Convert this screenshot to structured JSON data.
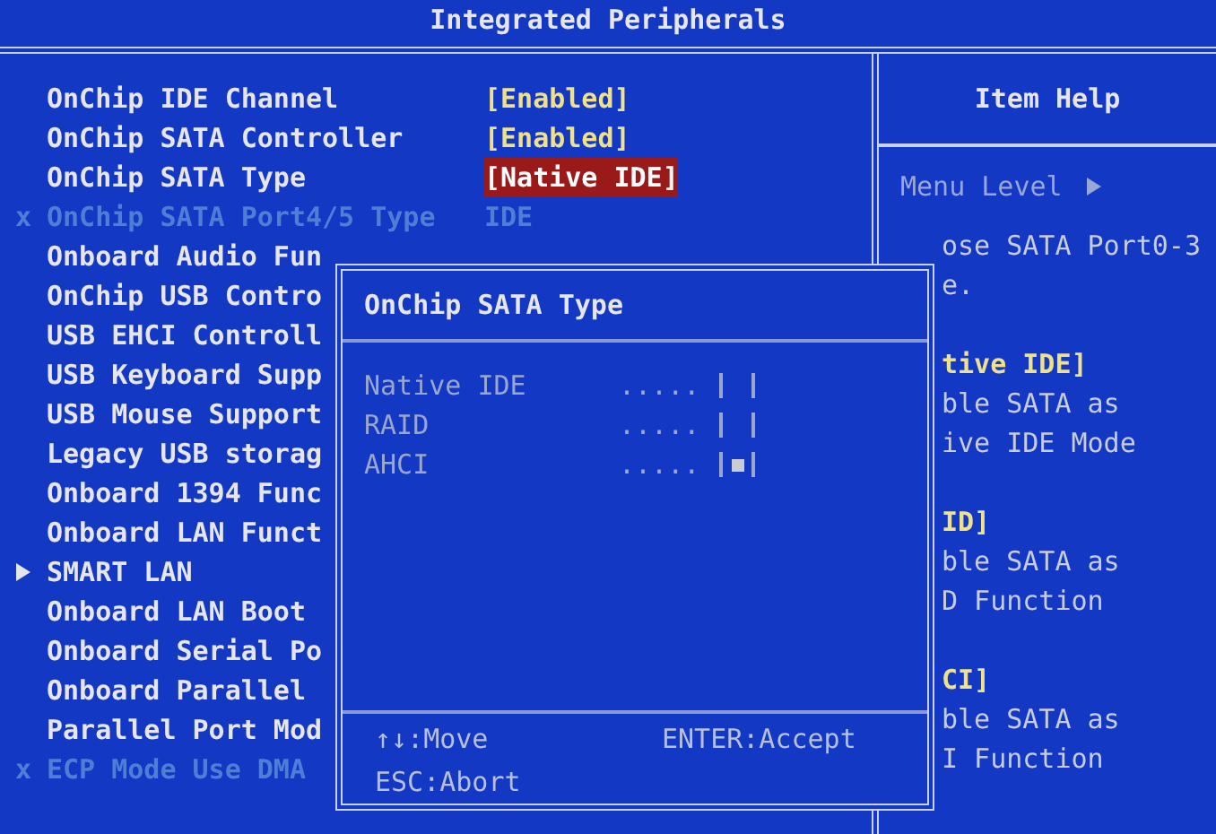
{
  "header": {
    "title": "Integrated Peripherals"
  },
  "items": [
    {
      "label": "OnChip IDE Channel",
      "kind": "setting",
      "value": "[Enabled]",
      "selected": false
    },
    {
      "label": "OnChip SATA Controller",
      "kind": "setting",
      "value": "[Enabled]",
      "selected": false
    },
    {
      "label": "OnChip SATA Type",
      "kind": "setting",
      "value": "[Native IDE]",
      "selected": true
    },
    {
      "label": "OnChip SATA Port4/5 Type",
      "kind": "disabled",
      "prefix": "x",
      "value": "IDE",
      "selected": false
    },
    {
      "label": "Onboard Audio Fun",
      "kind": "setting"
    },
    {
      "label": "OnChip USB Contro",
      "kind": "setting"
    },
    {
      "label": "USB EHCI Controll",
      "kind": "setting"
    },
    {
      "label": "USB Keyboard Supp",
      "kind": "setting"
    },
    {
      "label": "USB Mouse Support",
      "kind": "setting"
    },
    {
      "label": "Legacy USB storag",
      "kind": "setting"
    },
    {
      "label": "Onboard 1394 Func",
      "kind": "setting"
    },
    {
      "label": "Onboard LAN Funct",
      "kind": "setting"
    },
    {
      "label": "SMART LAN",
      "kind": "submenu"
    },
    {
      "label": "Onboard LAN Boot",
      "kind": "setting"
    },
    {
      "label": "Onboard Serial Po",
      "kind": "setting"
    },
    {
      "label": "Onboard Parallel",
      "kind": "setting"
    },
    {
      "label": "Parallel Port Mod",
      "kind": "setting"
    },
    {
      "label": "ECP Mode Use DMA",
      "kind": "disabled",
      "prefix": "x"
    }
  ],
  "help": {
    "title": "Item Help",
    "menu_level": "Menu Level",
    "paragraphs": [
      [
        {
          "text": "ose SATA Port0-3",
          "kind": "text"
        },
        {
          "text": "e.",
          "kind": "text"
        }
      ],
      [
        {
          "text": "tive IDE]",
          "kind": "heading"
        },
        {
          "text": "ble SATA as",
          "kind": "text"
        },
        {
          "text": "ive IDE Mode",
          "kind": "text"
        }
      ],
      [
        {
          "text": "ID]",
          "kind": "heading"
        },
        {
          "text": "ble SATA as",
          "kind": "text"
        },
        {
          "text": "D Function",
          "kind": "text"
        }
      ],
      [
        {
          "text": "CI]",
          "kind": "heading"
        },
        {
          "text": "ble SATA as",
          "kind": "text"
        },
        {
          "text": "I Function",
          "kind": "text"
        }
      ]
    ]
  },
  "popup": {
    "title": "OnChip SATA Type",
    "options": [
      {
        "label": "Native IDE",
        "leader": ".....",
        "checked": false
      },
      {
        "label": "RAID",
        "leader": ".....",
        "checked": false
      },
      {
        "label": "AHCI",
        "leader": ".....",
        "checked": true
      }
    ],
    "keys": [
      {
        "text": "↑↓:Move"
      },
      {
        "text": "ENTER:Accept"
      },
      {
        "text": "ESC:Abort"
      }
    ]
  }
}
